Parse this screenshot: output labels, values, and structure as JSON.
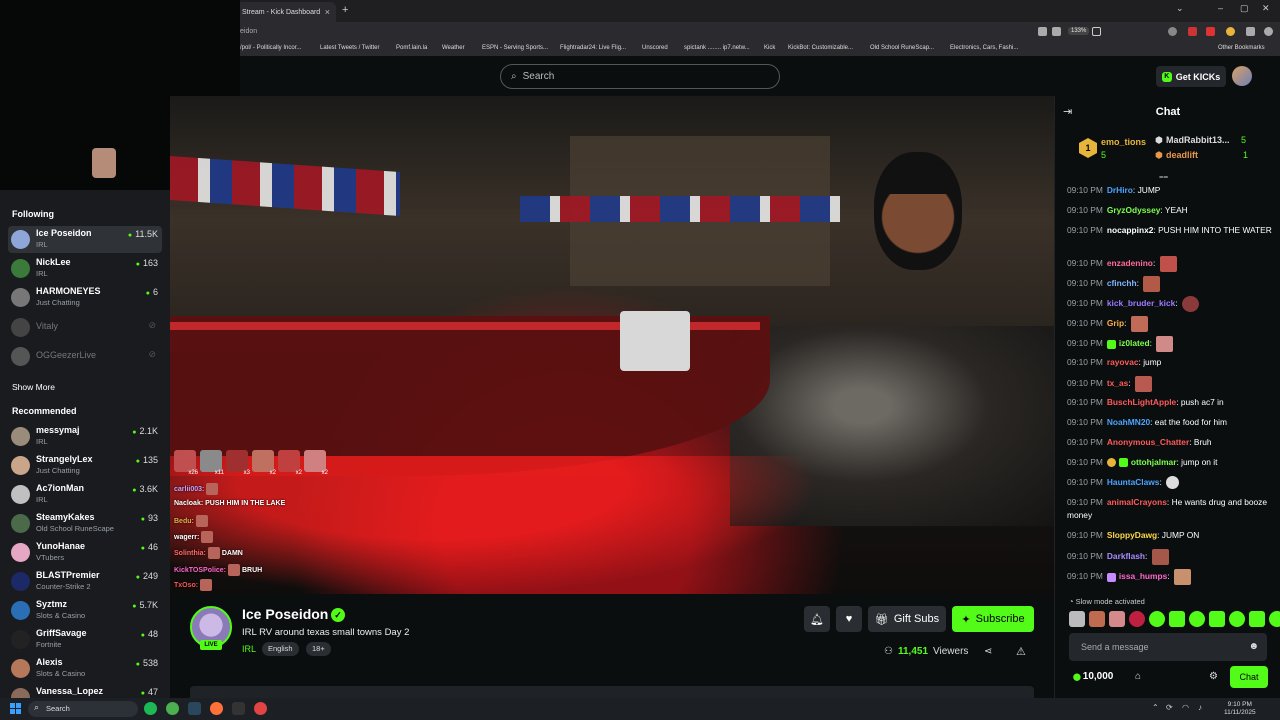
{
  "browser": {
    "tab_title": "Stream - Kick Dashboard",
    "tab_close": "×",
    "new_tab": "+",
    "window_controls": [
      "⌄",
      "–",
      "▢",
      "✕"
    ],
    "address_fragment": "eidon",
    "zoom": "133%",
    "bookmarks": [
      "/pol/ - Politically Incor...",
      "Latest Tweets / Twitter",
      "Pomf.lain.la",
      "Weather",
      "ESPN - Serving Sports...",
      "Flightradar24: Live Flig...",
      "Unscored",
      "spictank ........ ip7.netw...",
      "Kick",
      "KickBot: Customizable...",
      "Old School RuneScap...",
      "Electronics, Cars, Fashi..."
    ],
    "other_bookmarks": "Other Bookmarks"
  },
  "header": {
    "search_placeholder": "Search",
    "get_kicks": "Get KICKs"
  },
  "webcam": {
    "time_fragment": "PM"
  },
  "sidebar": {
    "following_title": "Following",
    "following": [
      {
        "name": "Ice Poseidon",
        "category": "IRL",
        "viewers": "11.5K",
        "color": "#8fa6d8",
        "active": true
      },
      {
        "name": "NickLee",
        "category": "IRL",
        "viewers": "163",
        "color": "#3b7a3b"
      },
      {
        "name": "HARMONEYES",
        "category": "Just Chatting",
        "viewers": "6",
        "color": "#777777"
      },
      {
        "name": "Vitaly",
        "offline": true,
        "color": "#444444"
      },
      {
        "name": "OGGeezerLive",
        "offline": true,
        "color": "#555555"
      }
    ],
    "show_more": "Show More",
    "recommended_title": "Recommended",
    "recommended": [
      {
        "name": "messymaj",
        "category": "IRL",
        "viewers": "2.1K",
        "color": "#9a8c7a"
      },
      {
        "name": "StrangelyLex",
        "category": "Just Chatting",
        "viewers": "135",
        "color": "#c9a58a"
      },
      {
        "name": "Ac7ionMan",
        "category": "IRL",
        "viewers": "3.6K",
        "color": "#c0c0c0"
      },
      {
        "name": "SteamyKakes",
        "category": "Old School RuneScape",
        "viewers": "93",
        "color": "#4a6a4a"
      },
      {
        "name": "YunoHanae",
        "category": "VTubers",
        "viewers": "46",
        "color": "#e6a7c5"
      },
      {
        "name": "BLASTPremier",
        "category": "Counter-Strike 2",
        "viewers": "249",
        "color": "#1b2a66"
      },
      {
        "name": "Syztmz",
        "category": "Slots & Casino",
        "viewers": "5.7K",
        "color": "#2a6fb5"
      },
      {
        "name": "GriffSavage",
        "category": "Fortnite",
        "viewers": "48",
        "color": "#222222"
      },
      {
        "name": "Alexis",
        "category": "Slots & Casino",
        "viewers": "538",
        "color": "#b5785a"
      },
      {
        "name": "Vanessa_Lopez",
        "category": "",
        "viewers": "47",
        "color": "#8a6a5a"
      }
    ]
  },
  "overlay_chat": {
    "emotes": [
      {
        "count": "x26",
        "color": "#c05050"
      },
      {
        "count": "x11",
        "color": "#8a8a8a"
      },
      {
        "count": "x3",
        "color": "#a03030"
      },
      {
        "count": "x2",
        "color": "#c07060"
      },
      {
        "count": "x2",
        "color": "#c04040"
      },
      {
        "count": "x2",
        "color": "#d08080"
      }
    ],
    "lines": [
      {
        "user": "carlii003:",
        "color": "#c7a3ff",
        "msg": ""
      },
      {
        "user": "Nacloak:",
        "color": "#ffffff",
        "msg": "PUSH HIM IN THE LAKE"
      },
      {
        "user": "Bedu:",
        "color": "#e8b04a",
        "msg": ""
      },
      {
        "user": "wagerr:",
        "color": "#ffffff",
        "msg": ""
      },
      {
        "user": "Solinthia:",
        "color": "#ff6a6a",
        "msg": "DAMN"
      },
      {
        "user": "KickTOSPolice:",
        "color": "#ff66cc",
        "msg": "BRUH"
      },
      {
        "user": "TxOso:",
        "color": "#ff5555",
        "msg": ""
      }
    ]
  },
  "stream": {
    "streamer": "Ice Poseidon",
    "title": "IRL RV around texas small towns Day 2",
    "category": "IRL",
    "tags": [
      "English",
      "18+"
    ],
    "live": "LIVE",
    "viewers": "11,451",
    "viewers_label": "Viewers",
    "gift_subs": "Gift Subs",
    "subscribe": "Subscribe"
  },
  "chat": {
    "title": "Chat",
    "top_gifters": [
      {
        "rank": "1",
        "name": "emo_tions",
        "count": "5",
        "color": "#e7b53b"
      },
      {
        "name": "MadRabbit13...",
        "count": "5",
        "color": "#dddddd"
      },
      {
        "name": "deadlift",
        "count": "1",
        "color": "#e8974a"
      }
    ],
    "messages": [
      {
        "time": "09:10 PM",
        "user": "DrHiro",
        "color": "#4da3ff",
        "text": "JUMP"
      },
      {
        "time": "09:10 PM",
        "user": "GryzOdyssey",
        "color": "#7dff4d",
        "text": "YEAH"
      },
      {
        "time": "09:10 PM",
        "user": "nocappinx2",
        "color": "#ffffff",
        "text": "PUSH HIM INTO THE WATER"
      },
      {
        "time": "09:10 PM",
        "user": "enzadenino",
        "color": "#ff6b9a",
        "text": "",
        "emote": true
      },
      {
        "time": "09:10 PM",
        "user": "cfinchh",
        "color": "#7fb6ff",
        "text": "",
        "emote": true
      },
      {
        "time": "09:10 PM",
        "user": "kick_bruder_kick",
        "color": "#9a7bff",
        "text": "",
        "emote": true
      },
      {
        "time": "09:10 PM",
        "user": "Grip",
        "color": "#ffb04a",
        "text": "",
        "emote": true
      },
      {
        "time": "09:10 PM",
        "user": "iz0lated",
        "color": "#7dff4d",
        "text": "",
        "emote": true,
        "badge": true
      },
      {
        "time": "09:10 PM",
        "user": "rayovac",
        "color": "#ff5a5a",
        "text": "jump"
      },
      {
        "time": "09:10 PM",
        "user": "tx_as",
        "color": "#ff5a5a",
        "text": "",
        "emote": true
      },
      {
        "time": "09:10 PM",
        "user": "BuschLightApple",
        "color": "#ff5a5a",
        "text": "push ac7 in"
      },
      {
        "time": "09:10 PM",
        "user": "NoahMN20",
        "color": "#4da3ff",
        "text": "eat the food for him"
      },
      {
        "time": "09:10 PM",
        "user": "Anonymous_Chatter",
        "color": "#ff5a5a",
        "text": "Bruh"
      },
      {
        "time": "09:10 PM",
        "user": "ottohjalmar",
        "color": "#7dff4d",
        "text": "jump on it",
        "badge": true
      },
      {
        "time": "09:10 PM",
        "user": "HauntaClaws",
        "color": "#4da3ff",
        "text": "",
        "emote": true
      },
      {
        "time": "09:10 PM",
        "user": "animalCrayons",
        "color": "#ff5a5a",
        "text": "He wants drug and booze money"
      },
      {
        "time": "09:10 PM",
        "user": "SloppyDawg",
        "color": "#ffd84a",
        "text": "JUMP ON"
      },
      {
        "time": "09:10 PM",
        "user": "Darkflash",
        "color": "#a98bff",
        "text": "",
        "emote": true
      },
      {
        "time": "09:10 PM",
        "user": "issa_humps",
        "color": "#ff66cc",
        "text": "",
        "emote": true,
        "badge": true
      }
    ],
    "slow_mode": "Slow mode activated",
    "send_placeholder": "Send a message",
    "points": "10,000",
    "chat_button": "Chat"
  },
  "taskbar": {
    "search": "Search",
    "time": "9:10 PM",
    "date": "11/11/2025"
  }
}
